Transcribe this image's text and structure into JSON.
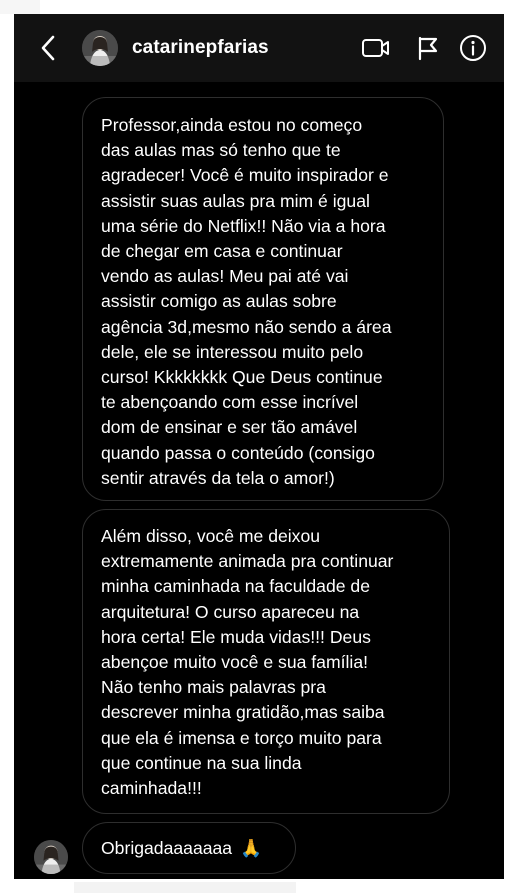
{
  "header": {
    "username": "catarinepfarias",
    "back_icon": "chevron-left-icon",
    "video_icon": "video-camera-icon",
    "flag_icon": "flag-icon",
    "info_icon": "info-icon"
  },
  "messages": [
    {
      "lines": [
        "Professor,ainda estou no começo",
        "das aulas mas só tenho que te",
        "agradecer! Você é muito inspirador e",
        "assistir suas aulas pra mim é igual",
        "uma série do Netflix!! Não via a hora",
        "de chegar em casa e continuar",
        "vendo as aulas! Meu pai até vai",
        "assistir comigo as aulas sobre",
        "agência 3d,mesmo não sendo a área",
        "dele, ele se interessou muito pelo",
        "curso! Kkkkkkkk Que Deus continue",
        "te abençoando com esse incrível",
        "dom de ensinar e ser tão amável",
        "quando passa o conteúdo (consigo",
        "sentir através da tela o amor!)"
      ]
    },
    {
      "lines": [
        "Além disso, você me deixou",
        "extremamente animada pra continuar",
        "minha caminhada na faculdade de",
        "arquitetura! O curso apareceu na",
        "hora certa! Ele muda vidas!!! Deus",
        "abençoe muito você e sua família!",
        "Não tenho mais palavras pra",
        "descrever minha gratidão,mas saiba",
        "que ela é imensa e torço muito para",
        "que continue na sua linda",
        "caminhada!!!"
      ]
    },
    {
      "text": "Obrigadaaaaaaa",
      "emoji": "🙏"
    }
  ],
  "colors": {
    "background": "#000000",
    "header": "#121212",
    "bubble_border": "#2e2e2e",
    "text": "#ffffff"
  }
}
